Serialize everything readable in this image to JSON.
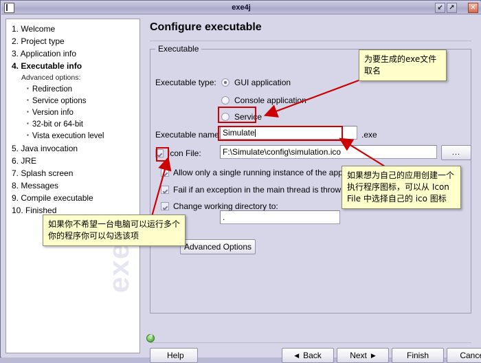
{
  "window": {
    "title": "exe4j",
    "app_icon": "chart-icon",
    "controls": [
      {
        "name": "minimize",
        "glyph": "↙"
      },
      {
        "name": "maximize",
        "glyph": "↗"
      },
      {
        "name": "close",
        "glyph": "✕"
      }
    ]
  },
  "sidebar": {
    "watermark": "exe4j",
    "items": [
      {
        "label": "1. Welcome",
        "type": "step",
        "active": false
      },
      {
        "label": "2. Project type",
        "type": "step",
        "active": false
      },
      {
        "label": "3. Application info",
        "type": "step",
        "active": false
      },
      {
        "label": "4. Executable info",
        "type": "step",
        "active": true
      },
      {
        "label": "Advanced options:",
        "type": "subhead",
        "active": false
      },
      {
        "label": "Redirection",
        "type": "bullet",
        "active": false
      },
      {
        "label": "Service options",
        "type": "bullet",
        "active": false
      },
      {
        "label": "Version info",
        "type": "bullet",
        "active": false
      },
      {
        "label": "32-bit or 64-bit",
        "type": "bullet",
        "active": false
      },
      {
        "label": "Vista execution level",
        "type": "bullet",
        "active": false
      },
      {
        "label": "5. Java invocation",
        "type": "step",
        "active": false
      },
      {
        "label": "6. JRE",
        "type": "step",
        "active": false
      },
      {
        "label": "7. Splash screen",
        "type": "step",
        "active": false
      },
      {
        "label": "8. Messages",
        "type": "step",
        "active": false
      },
      {
        "label": "9. Compile executable",
        "type": "step",
        "active": false
      },
      {
        "label": "10. Finished",
        "type": "step",
        "active": false
      }
    ]
  },
  "main": {
    "page_title": "Configure executable",
    "group_legend": "Executable",
    "executable_type_label": "Executable type:",
    "radios": [
      {
        "label": "GUI application",
        "selected": true
      },
      {
        "label": "Console application",
        "selected": false
      },
      {
        "label": "Service",
        "selected": false
      }
    ],
    "executable_name_label": "Executable name:",
    "executable_name_value": "Simulate",
    "executable_name_suffix": ".exe",
    "icon_file_label": "Icon File:",
    "icon_file_checked": true,
    "icon_file_value": "F:\\Simulate\\config\\simulation.ico",
    "browse_button_label": "...",
    "checkboxes": [
      {
        "label": "Allow only a single running instance of the application",
        "checked": true
      },
      {
        "label": "Fail if an exception in the main thread is thrown",
        "checked": true
      },
      {
        "label": "Change working directory to:",
        "checked": true
      }
    ],
    "working_directory_value": ".",
    "advanced_options_label": "Advanced Options"
  },
  "footer": {
    "help_label": "Help",
    "help_icon": "question-circle-icon",
    "back_label": "Back",
    "next_label": "Next",
    "finish_label": "Finish",
    "cancel_label": "Cancel"
  },
  "annotations": {
    "accent_color": "#cc0000",
    "note_background": "#ffffcc",
    "notes": [
      {
        "name": "note-exe-name",
        "text": "为要生成的exe文件取名"
      },
      {
        "name": "note-icon-file",
        "text": "如果想为自己的应用创建一个执行程序图标，可以从 Icon File 中选择自己的 ico 图标"
      },
      {
        "name": "note-single-instance",
        "text": "如果你不希望一台电脑可以运行多个你的程序你可以勾选该项"
      }
    ]
  }
}
